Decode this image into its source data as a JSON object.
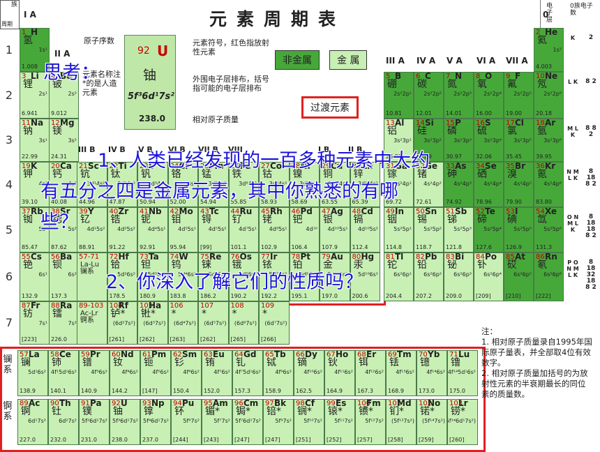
{
  "title": "元素周期表",
  "corner": {
    "a": "族",
    "b": "周期",
    "c": "电子层",
    "d": "0族电子数"
  },
  "periods": [
    "1",
    "2",
    "3",
    "4",
    "5",
    "6",
    "7"
  ],
  "groups_top": {
    "ia": "I A",
    "zero": "0",
    "iia": "II A",
    "iiia": "III A",
    "iva": "IV A",
    "va": "V A",
    "via": "VI A",
    "viia": "VII A"
  },
  "groups_mid": [
    "III B",
    "IV B",
    "V B",
    "VI B",
    "VII B",
    "VIII",
    "",
    "",
    "I B",
    "II B"
  ],
  "legend": {
    "z": "92",
    "sym": "U",
    "name": "铀",
    "cfg": "5f³6d¹7s²",
    "mass": "238.0",
    "lbl_z": "原子序数",
    "lbl_name": "元素名称注*的是人造元素",
    "lbl_sym": "元素符号，红色指放射性元素",
    "lbl_cfg": "外围电子层排布，括号指可能的电子层排布",
    "lbl_mass": "相对原子质量"
  },
  "tags": {
    "nonmetal": "非金属",
    "metal": "金 属",
    "transition": "过渡元素"
  },
  "elements": [
    {
      "z": "1",
      "s": "H",
      "n": "氢",
      "c": "1s¹",
      "m": "1.008"
    },
    {
      "z": "2",
      "s": "He",
      "n": "氦",
      "c": "1s²",
      "m": "4.003"
    },
    {
      "z": "3",
      "s": "Li",
      "n": "锂",
      "c": "2s¹",
      "m": "6.941"
    },
    {
      "z": "4",
      "s": "Be",
      "n": "铍",
      "c": "2s²",
      "m": "9.012"
    },
    {
      "z": "5",
      "s": "B",
      "n": "硼",
      "c": "2s²2p¹",
      "m": "10.81"
    },
    {
      "z": "6",
      "s": "C",
      "n": "碳",
      "c": "2s²2p²",
      "m": "12.01"
    },
    {
      "z": "7",
      "s": "N",
      "n": "氮",
      "c": "2s²2p³",
      "m": "14.01"
    },
    {
      "z": "8",
      "s": "O",
      "n": "氧",
      "c": "2s²2p⁴",
      "m": "16.00"
    },
    {
      "z": "9",
      "s": "F",
      "n": "氟",
      "c": "2s²2p⁵",
      "m": "19.00"
    },
    {
      "z": "10",
      "s": "Ne",
      "n": "氖",
      "c": "2s²2p⁶",
      "m": "20.18"
    },
    {
      "z": "11",
      "s": "Na",
      "n": "钠",
      "c": "3s¹",
      "m": "22.99"
    },
    {
      "z": "12",
      "s": "Mg",
      "n": "镁",
      "c": "3s²",
      "m": "24.31"
    },
    {
      "z": "13",
      "s": "Al",
      "n": "铝",
      "c": "3s²3p¹",
      "m": "26.98"
    },
    {
      "z": "14",
      "s": "Si",
      "n": "硅",
      "c": "3s²3p²",
      "m": "28.09"
    },
    {
      "z": "15",
      "s": "P",
      "n": "磷",
      "c": "3s²3p³",
      "m": "30.97"
    },
    {
      "z": "16",
      "s": "S",
      "n": "硫",
      "c": "3s²3p⁴",
      "m": "32.06"
    },
    {
      "z": "17",
      "s": "Cl",
      "n": "氯",
      "c": "3s²3p⁵",
      "m": "35.45"
    },
    {
      "z": "18",
      "s": "Ar",
      "n": "氩",
      "c": "3s²3p⁶",
      "m": "39.95"
    },
    {
      "z": "19",
      "s": "K",
      "n": "钾",
      "c": "4s¹",
      "m": "39.10"
    },
    {
      "z": "20",
      "s": "Ca",
      "n": "钙",
      "c": "4s²",
      "m": "40.08"
    },
    {
      "z": "31",
      "s": "Ga",
      "n": "镓",
      "c": "4s²4p¹",
      "m": "69.72"
    },
    {
      "z": "32",
      "s": "Ge",
      "n": "锗",
      "c": "4s²4p²",
      "m": "72.61"
    },
    {
      "z": "33",
      "s": "As",
      "n": "砷",
      "c": "4s²4p³",
      "m": "74.92"
    },
    {
      "z": "34",
      "s": "Se",
      "n": "硒",
      "c": "4s²4p⁴",
      "m": "78.96"
    },
    {
      "z": "35",
      "s": "Br",
      "n": "溴",
      "c": "4s²4p⁵",
      "m": "79.90"
    },
    {
      "z": "36",
      "s": "Kr",
      "n": "氪",
      "c": "4s²4p⁶",
      "m": "83.80"
    },
    {
      "z": "37",
      "s": "Rb",
      "n": "铷",
      "c": "5s¹",
      "m": "85.47"
    },
    {
      "z": "38",
      "s": "Sr",
      "n": "锶",
      "c": "5s²",
      "m": "87.62"
    },
    {
      "z": "49",
      "s": "In",
      "n": "铟",
      "c": "5s²5p¹",
      "m": "114.8"
    },
    {
      "z": "50",
      "s": "Sn",
      "n": "锡",
      "c": "5s²5p²",
      "m": "118.7"
    },
    {
      "z": "51",
      "s": "Sb",
      "n": "锑",
      "c": "5s²5p³",
      "m": "121.8"
    },
    {
      "z": "52",
      "s": "Te",
      "n": "碲",
      "c": "5s²5p⁴",
      "m": "127.6"
    },
    {
      "z": "53",
      "s": "I",
      "n": "碘",
      "c": "5s²5p⁵",
      "m": "126.9"
    },
    {
      "z": "54",
      "s": "Xe",
      "n": "氙",
      "c": "5s²5p⁶",
      "m": "131.3"
    },
    {
      "z": "55",
      "s": "Cs",
      "n": "铯",
      "c": "6s¹",
      "m": "132.9"
    },
    {
      "z": "56",
      "s": "Ba",
      "n": "钡",
      "c": "6s²",
      "m": "137.3"
    },
    {
      "z": "81",
      "s": "Tl",
      "n": "铊",
      "c": "6s²6p¹",
      "m": "204.4"
    },
    {
      "z": "82",
      "s": "Pb",
      "n": "铅",
      "c": "6s²6p²",
      "m": "207.2"
    },
    {
      "z": "83",
      "s": "Bi",
      "n": "铋",
      "c": "6s²6p³",
      "m": "209.0"
    },
    {
      "z": "84",
      "s": "Po",
      "n": "钋",
      "c": "6s²6p⁴",
      "m": "[209]"
    },
    {
      "z": "85",
      "s": "At",
      "n": "砹",
      "c": "6s²6p⁵",
      "m": "[210]"
    },
    {
      "z": "86",
      "s": "Rn",
      "n": "氡",
      "c": "6s²6p⁶",
      "m": "[222]"
    },
    {
      "z": "87",
      "s": "Fr",
      "n": "钫",
      "c": "7s¹",
      "m": "[223]"
    },
    {
      "z": "88",
      "s": "Ra",
      "n": "镭",
      "c": "7s²",
      "m": "226.0"
    }
  ],
  "transition": [
    {
      "z": "21",
      "s": "Sc",
      "n": "钪",
      "c": "3d¹4s²",
      "m": "44.96"
    },
    {
      "z": "22",
      "s": "Ti",
      "n": "钛",
      "c": "3d²4s²",
      "m": "47.87"
    },
    {
      "z": "23",
      "s": "V",
      "n": "钒",
      "c": "3d³4s²",
      "m": "50.94"
    },
    {
      "z": "24",
      "s": "Cr",
      "n": "铬",
      "c": "3d⁵4s¹",
      "m": "52.00"
    },
    {
      "z": "25",
      "s": "Mn",
      "n": "锰",
      "c": "3d⁵4s²",
      "m": "54.94"
    },
    {
      "z": "26",
      "s": "Fe",
      "n": "铁",
      "c": "3d⁶4s²",
      "m": "55.85"
    },
    {
      "z": "27",
      "s": "Co",
      "n": "钴",
      "c": "3d⁷4s²",
      "m": "58.93"
    },
    {
      "z": "28",
      "s": "Ni",
      "n": "镍",
      "c": "3d⁸4s²",
      "m": "58.69"
    },
    {
      "z": "29",
      "s": "Cu",
      "n": "铜",
      "c": "3d¹⁰4s¹",
      "m": "63.55"
    },
    {
      "z": "30",
      "s": "Zn",
      "n": "锌",
      "c": "3d¹⁰4s²",
      "m": "65.39"
    },
    {
      "z": "39",
      "s": "Y",
      "n": "钇",
      "c": "4d¹5s²",
      "m": "88.91"
    },
    {
      "z": "40",
      "s": "Zr",
      "n": "锆",
      "c": "4d²5s²",
      "m": "91.22"
    },
    {
      "z": "41",
      "s": "Nb",
      "n": "铌",
      "c": "4d⁴5s¹",
      "m": "92.91"
    },
    {
      "z": "42",
      "s": "Mo",
      "n": "钼",
      "c": "4d⁵5s¹",
      "m": "95.94"
    },
    {
      "z": "43",
      "s": "Tc",
      "n": "锝",
      "c": "4d⁵5s²",
      "m": "[99]"
    },
    {
      "z": "44",
      "s": "Ru",
      "n": "钌",
      "c": "4d⁷5s¹",
      "m": "101.1"
    },
    {
      "z": "45",
      "s": "Rh",
      "n": "铑",
      "c": "4d⁸5s¹",
      "m": "102.9"
    },
    {
      "z": "46",
      "s": "Pd",
      "n": "钯",
      "c": "4d¹⁰",
      "m": "106.4"
    },
    {
      "z": "47",
      "s": "Ag",
      "n": "银",
      "c": "4d¹⁰5s¹",
      "m": "107.9"
    },
    {
      "z": "48",
      "s": "Cd",
      "n": "镉",
      "c": "4d¹⁰5s²",
      "m": "112.4"
    },
    {
      "z": "57-71",
      "s": "",
      "n": "La-Lu 镧系",
      "c": "",
      "m": ""
    },
    {
      "z": "72",
      "s": "Hf",
      "n": "铪",
      "c": "5d²6s²",
      "m": "178.5"
    },
    {
      "z": "73",
      "s": "Ta",
      "n": "钽",
      "c": "5d³6s²",
      "m": "180.9"
    },
    {
      "z": "74",
      "s": "W",
      "n": "钨",
      "c": "5d⁴6s²",
      "m": "183.8"
    },
    {
      "z": "75",
      "s": "Re",
      "n": "铼",
      "c": "5d⁵6s²",
      "m": "186.2"
    },
    {
      "z": "76",
      "s": "Os",
      "n": "锇",
      "c": "5d⁶6s²",
      "m": "190.2"
    },
    {
      "z": "77",
      "s": "Ir",
      "n": "铱",
      "c": "5d⁷6s²",
      "m": "192.2"
    },
    {
      "z": "78",
      "s": "Pt",
      "n": "铂",
      "c": "5d⁹6s¹",
      "m": "195.1"
    },
    {
      "z": "79",
      "s": "Au",
      "n": "金",
      "c": "5d¹⁰6s¹",
      "m": "197.0"
    },
    {
      "z": "80",
      "s": "Hg",
      "n": "汞",
      "c": "5d¹⁰6s²",
      "m": "200.6"
    },
    {
      "z": "89-103",
      "s": "",
      "n": "Ac-Lr 锕系",
      "c": "",
      "m": ""
    },
    {
      "z": "104",
      "s": "Rf",
      "n": "𬬻*",
      "c": "(6d²7s²)",
      "m": "[261]"
    },
    {
      "z": "105",
      "s": "Ha",
      "n": "𬭊*",
      "c": "(6d³7s²)",
      "m": "[262]"
    },
    {
      "z": "106",
      "s": "",
      "n": "*",
      "c": "(6d⁴7s²)",
      "m": "[263]"
    },
    {
      "z": "107",
      "s": "",
      "n": "*",
      "c": "(6d⁵7s²)",
      "m": "[262]"
    },
    {
      "z": "108",
      "s": "",
      "n": "*",
      "c": "(6d⁶7s²)",
      "m": "[265]"
    },
    {
      "z": "109",
      "s": "",
      "n": "*",
      "c": "(6d⁷7s²)",
      "m": "[266]"
    }
  ],
  "lanthanides": [
    {
      "z": "57",
      "s": "La",
      "n": "镧",
      "c": "5d¹6s²",
      "m": "138.9"
    },
    {
      "z": "58",
      "s": "Ce",
      "n": "铈",
      "c": "4f¹5d¹6s²",
      "m": "140.1"
    },
    {
      "z": "59",
      "s": "Pr",
      "n": "镨",
      "c": "4f³6s²",
      "m": "140.9"
    },
    {
      "z": "60",
      "s": "Nd",
      "n": "钕",
      "c": "4f⁴6s²",
      "m": "144.2"
    },
    {
      "z": "61",
      "s": "Pm",
      "n": "钷",
      "c": "4f⁵6s²",
      "m": "[147]"
    },
    {
      "z": "62",
      "s": "Sm",
      "n": "钐",
      "c": "4f⁶6s²",
      "m": "150.4"
    },
    {
      "z": "63",
      "s": "Eu",
      "n": "铕",
      "c": "4f⁷6s²",
      "m": "152.0"
    },
    {
      "z": "64",
      "s": "Gd",
      "n": "钆",
      "c": "4f⁷5d¹6s²",
      "m": "157.3"
    },
    {
      "z": "65",
      "s": "Tb",
      "n": "铽",
      "c": "4f⁹6s²",
      "m": "158.9"
    },
    {
      "z": "66",
      "s": "Dy",
      "n": "镝",
      "c": "4f¹⁰6s²",
      "m": "162.5"
    },
    {
      "z": "67",
      "s": "Ho",
      "n": "钬",
      "c": "4f¹¹6s²",
      "m": "164.9"
    },
    {
      "z": "68",
      "s": "Er",
      "n": "铒",
      "c": "4f¹²6s²",
      "m": "167.3"
    },
    {
      "z": "69",
      "s": "Tm",
      "n": "铥",
      "c": "4f¹³6s²",
      "m": "168.9"
    },
    {
      "z": "70",
      "s": "Yb",
      "n": "镱",
      "c": "4f¹⁴6s²",
      "m": "173.0"
    },
    {
      "z": "71",
      "s": "Lu",
      "n": "镥",
      "c": "4f¹⁴5d¹6s²",
      "m": "175.0"
    }
  ],
  "actinides": [
    {
      "z": "89",
      "s": "Ac",
      "n": "锕",
      "c": "6d¹7s²",
      "m": "227.0"
    },
    {
      "z": "90",
      "s": "Th",
      "n": "钍",
      "c": "6d²7s²",
      "m": "232.0"
    },
    {
      "z": "91",
      "s": "Pa",
      "n": "镤",
      "c": "5f²6d¹7s²",
      "m": "231.0"
    },
    {
      "z": "92",
      "s": "U",
      "n": "铀",
      "c": "5f³6d¹7s²",
      "m": "238.0"
    },
    {
      "z": "93",
      "s": "Np",
      "n": "镎",
      "c": "5f⁴6d¹7s²",
      "m": "237.0"
    },
    {
      "z": "94",
      "s": "Pu",
      "n": "钚",
      "c": "5f⁶7s²",
      "m": "[244]"
    },
    {
      "z": "95",
      "s": "Am",
      "n": "镅*",
      "c": "5f⁷7s²",
      "m": "[243]"
    },
    {
      "z": "96",
      "s": "Cm",
      "n": "锔*",
      "c": "5f⁷6d¹7s²",
      "m": "[247]"
    },
    {
      "z": "97",
      "s": "Bk",
      "n": "锫*",
      "c": "5f⁹7s²",
      "m": "[247]"
    },
    {
      "z": "98",
      "s": "Cf",
      "n": "锎*",
      "c": "5f¹⁰7s²",
      "m": "[251]"
    },
    {
      "z": "99",
      "s": "Es",
      "n": "锿*",
      "c": "5f¹¹7s²",
      "m": "[252]"
    },
    {
      "z": "100",
      "s": "Fm",
      "n": "镄*",
      "c": "5f¹²7s²",
      "m": "[257]"
    },
    {
      "z": "101",
      "s": "Md",
      "n": "钔*",
      "c": "(5f¹³7s²)",
      "m": "[258]"
    },
    {
      "z": "102",
      "s": "No",
      "n": "锘*",
      "c": "(5f¹⁴7s²)",
      "m": "[259]"
    },
    {
      "z": "103",
      "s": "Lr",
      "n": "铹*",
      "c": "(5f¹⁴6d¹7s²)",
      "m": "[260]"
    }
  ],
  "series_labels": {
    "la": "镧系",
    "ac": "锕系"
  },
  "shells": [
    "K",
    "L K",
    "M L K",
    "N M L K",
    "O N M L K",
    "P O N M L K"
  ],
  "counts": [
    "2",
    "8 2",
    "8 8 2",
    "8 18 8 2",
    "8 18 18 8 2",
    "8 18 32 18 8 2"
  ],
  "notes": {
    "head": "注：",
    "n1": "1. 相对原子质量录自1995年国际原子量表，并全部取4位有效数字。",
    "n2": "2. 相对原子质量加括号的为放射性元素的半衰期最长的同位素的质量数。"
  },
  "overlay": {
    "think": "思考：",
    "q1a": "1、人类已经发现的一百多种元素中大约",
    "q1b": "有五分之四是金属元素，其中你熟悉的有哪",
    "q1c": "些？",
    "q2": "2、你深入了解它们的性质吗？"
  },
  "colors": {
    "metal": "#c8f0b4",
    "nonmetal": "#47a83a",
    "frame": "#e02020",
    "overlay": "#1c14d8"
  }
}
